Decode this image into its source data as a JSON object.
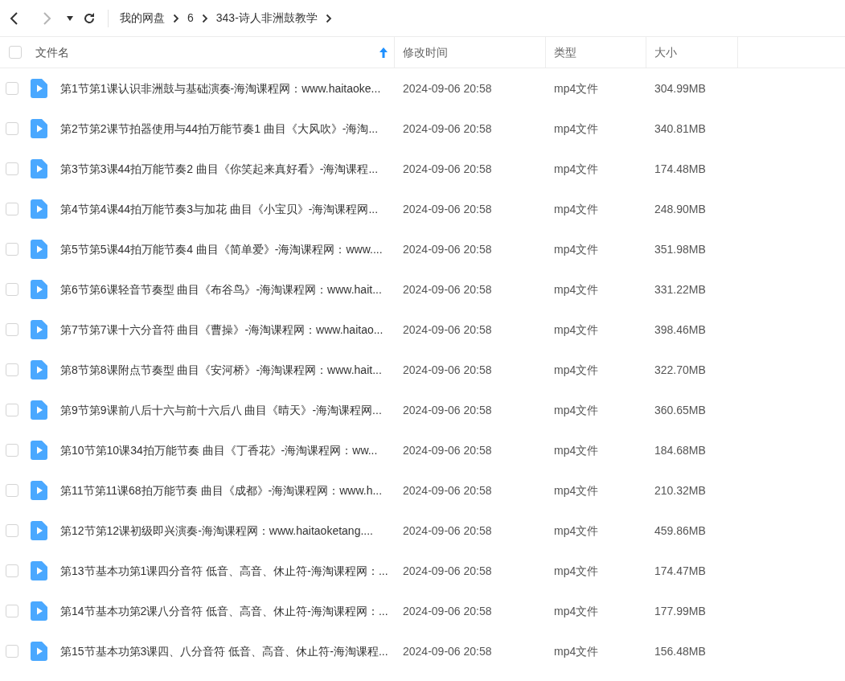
{
  "nav": {
    "back": {
      "disabled": false
    },
    "forward": {
      "disabled": true
    }
  },
  "breadcrumb": [
    "我的网盘",
    "6",
    "343-诗人非洲鼓教学"
  ],
  "table": {
    "select_all": {
      "checked": false
    },
    "columns": [
      {
        "label": "文件名",
        "sorted": true
      },
      {
        "label": "修改时间",
        "sorted": false
      },
      {
        "label": "类型",
        "sorted": false
      },
      {
        "label": "大小",
        "sorted": false
      }
    ],
    "rows": [
      {
        "checked": false,
        "name": "第1节第1课认识非洲鼓与基础演奏-海淘课程网：www.haitaoke...",
        "modified": "2024-09-06 20:58",
        "type": "mp4文件",
        "size": "304.99MB"
      },
      {
        "checked": false,
        "name": "第2节第2课节拍器使用与44拍万能节奏1 曲目《大风吹》-海淘...",
        "modified": "2024-09-06 20:58",
        "type": "mp4文件",
        "size": "340.81MB"
      },
      {
        "checked": false,
        "name": "第3节第3课44拍万能节奏2 曲目《你笑起来真好看》-海淘课程...",
        "modified": "2024-09-06 20:58",
        "type": "mp4文件",
        "size": "174.48MB"
      },
      {
        "checked": false,
        "name": "第4节第4课44拍万能节奏3与加花 曲目《小宝贝》-海淘课程网...",
        "modified": "2024-09-06 20:58",
        "type": "mp4文件",
        "size": "248.90MB"
      },
      {
        "checked": false,
        "name": "第5节第5课44拍万能节奏4 曲目《简单爱》-海淘课程网：www....",
        "modified": "2024-09-06 20:58",
        "type": "mp4文件",
        "size": "351.98MB"
      },
      {
        "checked": false,
        "name": "第6节第6课轻音节奏型 曲目《布谷鸟》-海淘课程网：www.hait...",
        "modified": "2024-09-06 20:58",
        "type": "mp4文件",
        "size": "331.22MB"
      },
      {
        "checked": false,
        "name": "第7节第7课十六分音符 曲目《曹操》-海淘课程网：www.haitao...",
        "modified": "2024-09-06 20:58",
        "type": "mp4文件",
        "size": "398.46MB"
      },
      {
        "checked": false,
        "name": "第8节第8课附点节奏型 曲目《安河桥》-海淘课程网：www.hait...",
        "modified": "2024-09-06 20:58",
        "type": "mp4文件",
        "size": "322.70MB"
      },
      {
        "checked": false,
        "name": "第9节第9课前八后十六与前十六后八 曲目《晴天》-海淘课程网...",
        "modified": "2024-09-06 20:58",
        "type": "mp4文件",
        "size": "360.65MB"
      },
      {
        "checked": false,
        "name": "第10节第10课34拍万能节奏 曲目《丁香花》-海淘课程网：ww...",
        "modified": "2024-09-06 20:58",
        "type": "mp4文件",
        "size": "184.68MB"
      },
      {
        "checked": false,
        "name": "第11节第11课68拍万能节奏 曲目《成都》-海淘课程网：www.h...",
        "modified": "2024-09-06 20:58",
        "type": "mp4文件",
        "size": "210.32MB"
      },
      {
        "checked": false,
        "name": "第12节第12课初级即兴演奏-海淘课程网：www.haitaoketang....",
        "modified": "2024-09-06 20:58",
        "type": "mp4文件",
        "size": "459.86MB"
      },
      {
        "checked": false,
        "name": "第13节基本功第1课四分音符 低音、高音、休止符-海淘课程网：...",
        "modified": "2024-09-06 20:58",
        "type": "mp4文件",
        "size": "174.47MB"
      },
      {
        "checked": false,
        "name": "第14节基本功第2课八分音符 低音、高音、休止符-海淘课程网：...",
        "modified": "2024-09-06 20:58",
        "type": "mp4文件",
        "size": "177.99MB"
      },
      {
        "checked": false,
        "name": "第15节基本功第3课四、八分音符 低音、高音、休止符-海淘课程...",
        "modified": "2024-09-06 20:58",
        "type": "mp4文件",
        "size": "156.48MB"
      }
    ]
  }
}
